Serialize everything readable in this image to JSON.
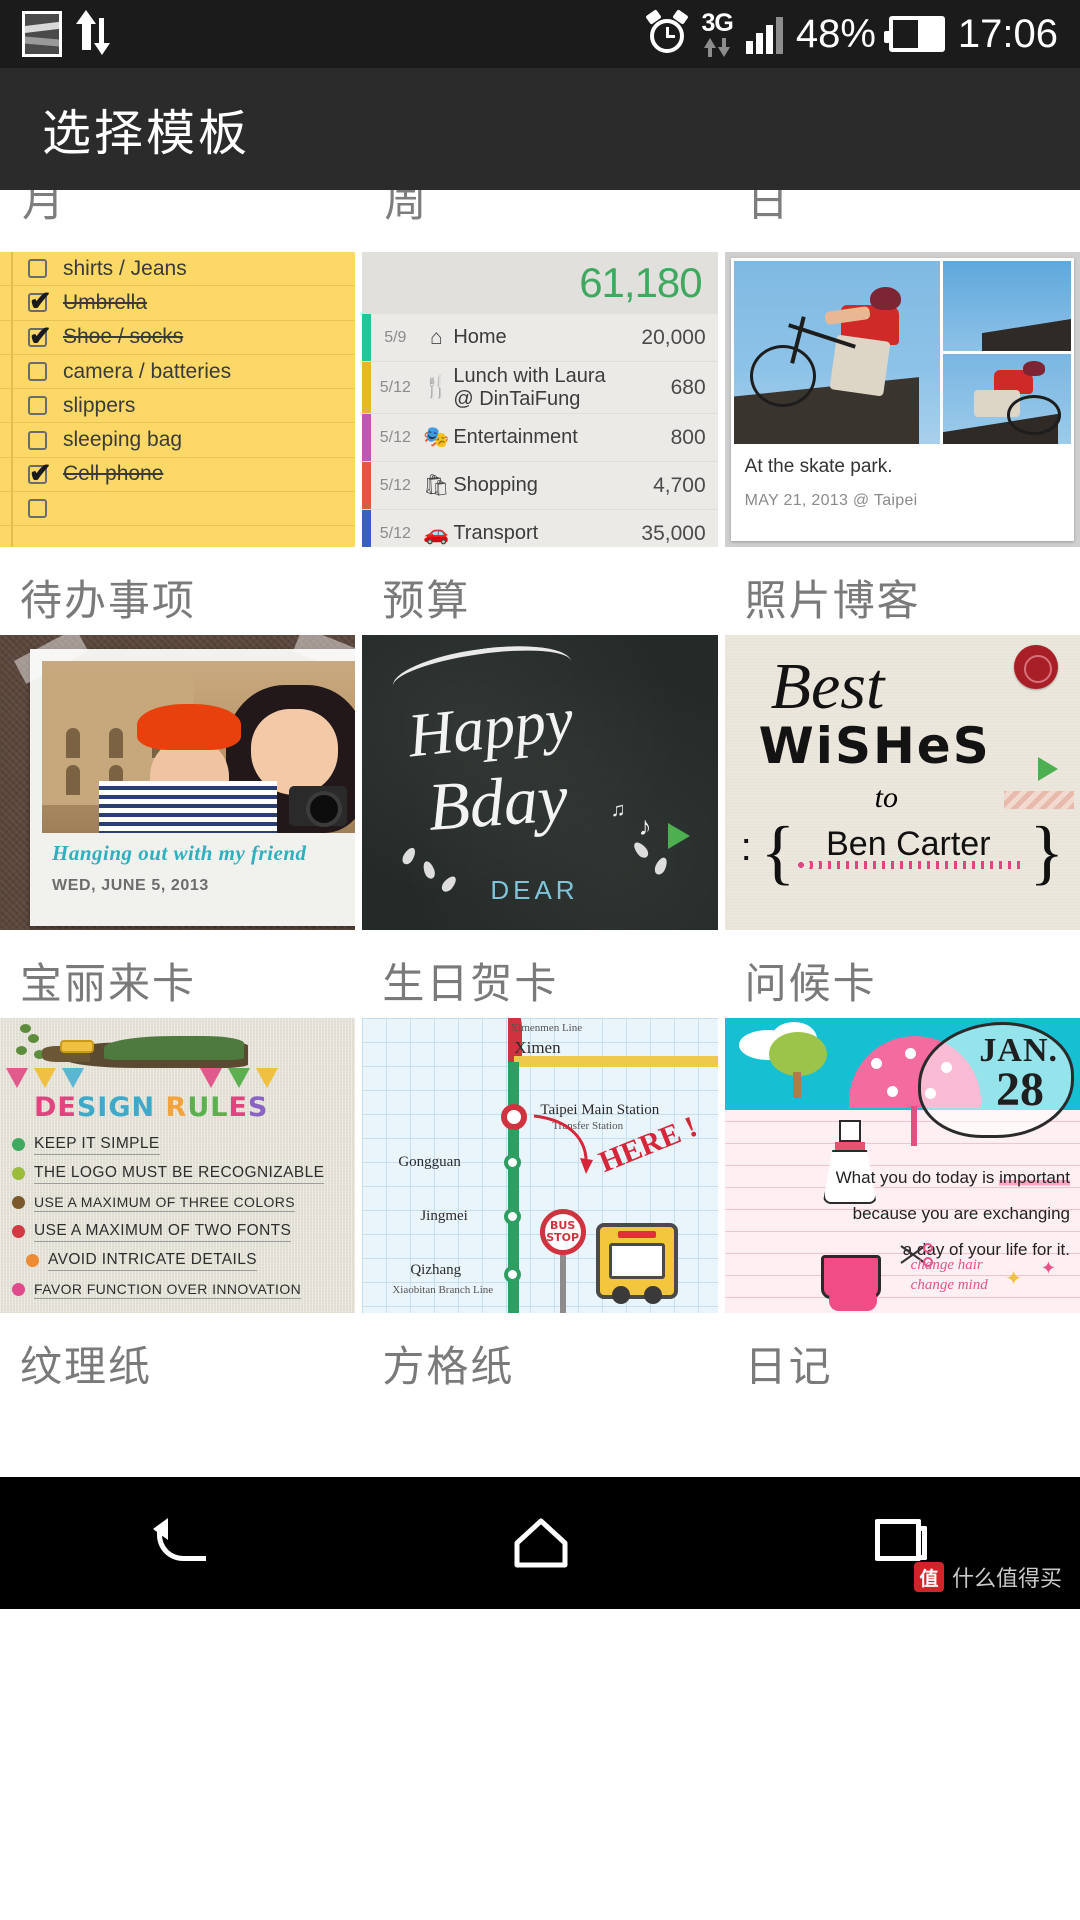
{
  "status_bar": {
    "time": "17:06",
    "battery_percent": "48%",
    "network_type": "3G",
    "icons": [
      "picture-icon",
      "data-transfer-icon",
      "alarm-icon",
      "3g-icon",
      "signal-icon",
      "battery-icon"
    ]
  },
  "header": {
    "title": "选择模板"
  },
  "peek_row": {
    "labels": [
      "月",
      "周",
      "日"
    ]
  },
  "templates": [
    {
      "label": "待办事项",
      "type": "todo",
      "items": [
        {
          "text": "shirts / Jeans",
          "checked": false
        },
        {
          "text": "Umbrella",
          "checked": true
        },
        {
          "text": "Shoe / socks",
          "checked": true
        },
        {
          "text": "camera / batteries",
          "checked": false
        },
        {
          "text": "slippers",
          "checked": false
        },
        {
          "text": "sleeping bag",
          "checked": false
        },
        {
          "text": "Cell phone",
          "checked": true
        },
        {
          "text": "",
          "checked": false
        }
      ]
    },
    {
      "label": "预算",
      "type": "budget",
      "total": "61,180",
      "rows": [
        {
          "date": "5/9",
          "icon": "home-icon",
          "name": "Home",
          "amount": "20,000",
          "color": "#27c49a"
        },
        {
          "date": "5/12",
          "icon": "restaurant-icon",
          "name": "Lunch with Laura\n@ DinTaiFung",
          "amount": "680",
          "color": "#e8b626"
        },
        {
          "date": "5/12",
          "icon": "entertainment-icon",
          "name": "Entertainment",
          "amount": "800",
          "color": "#c354b6"
        },
        {
          "date": "5/12",
          "icon": "shopping-bag-icon",
          "name": "Shopping",
          "amount": "4,700",
          "color": "#e05a3a"
        },
        {
          "date": "5/12",
          "icon": "car-icon",
          "name": "Transport",
          "amount": "35,000",
          "color": "#3b5fc0"
        }
      ]
    },
    {
      "label": "照片博客",
      "type": "photo-blog",
      "caption": "At the skate park.",
      "meta": "MAY 21, 2013 @ Taipei"
    },
    {
      "label": "宝丽来卡",
      "type": "polaroid",
      "caption": "Hanging out with my friend",
      "date": "WED, JUNE 5, 2013"
    },
    {
      "label": "生日贺卡",
      "type": "birthday-card",
      "line1": "Happy",
      "line2": "Bday",
      "line3": "DEAR"
    },
    {
      "label": "问候卡",
      "type": "greeting-card",
      "best": "Best",
      "wishes": "WiSHeS",
      "to": "to",
      "name": "Ben Carter"
    },
    {
      "label": "纹理纸",
      "type": "texture-paper",
      "title_letters": [
        "DE",
        "SIGN",
        " R",
        "UL",
        "E",
        "S"
      ],
      "title": "DESIGN RULES",
      "rules": [
        {
          "text": "KEEP IT SIMPLE",
          "color": "#3fa95f"
        },
        {
          "text": "THE LOGO MUST BE RECOGNIZABLE",
          "color": "#9bbd3c"
        },
        {
          "text": "USE A MAXIMUM OF THREE COLORS",
          "color": "#7a5a2c"
        },
        {
          "text": "USE A MAXIMUM OF TWO FONTS",
          "color": "#d13a43"
        },
        {
          "text": "AVOID INTRICATE DETAILS",
          "color": "#ef8b33"
        },
        {
          "text": "FAVOR FUNCTION OVER INNOVATION",
          "color": "#e04b8e"
        }
      ]
    },
    {
      "label": "方格纸",
      "type": "grid-paper",
      "stations": [
        "Ximen",
        "Taipei Main Station",
        "Gongguan",
        "Jingmei",
        "Qizhang"
      ],
      "line_label_top": "Ximenmen Line",
      "transfer_label": "Transfer Station",
      "branch_label": "Xiaobitan Branch Line",
      "here": "HERE !",
      "bus_stop": "BUS STOP"
    },
    {
      "label": "日记",
      "type": "diary",
      "month": "JAN.",
      "day": "28",
      "quote_line1": "What you do today is important",
      "quote_line2": "because you are exchanging",
      "quote_line3": "a day of your life for it.",
      "highlight_word": "important",
      "note_line1": "change hair",
      "note_line2": "change mind"
    }
  ],
  "navbar": {
    "buttons": [
      "back-button",
      "home-button",
      "recent-apps-button"
    ]
  },
  "watermark": {
    "mark": "值",
    "text": "什么值得买"
  }
}
